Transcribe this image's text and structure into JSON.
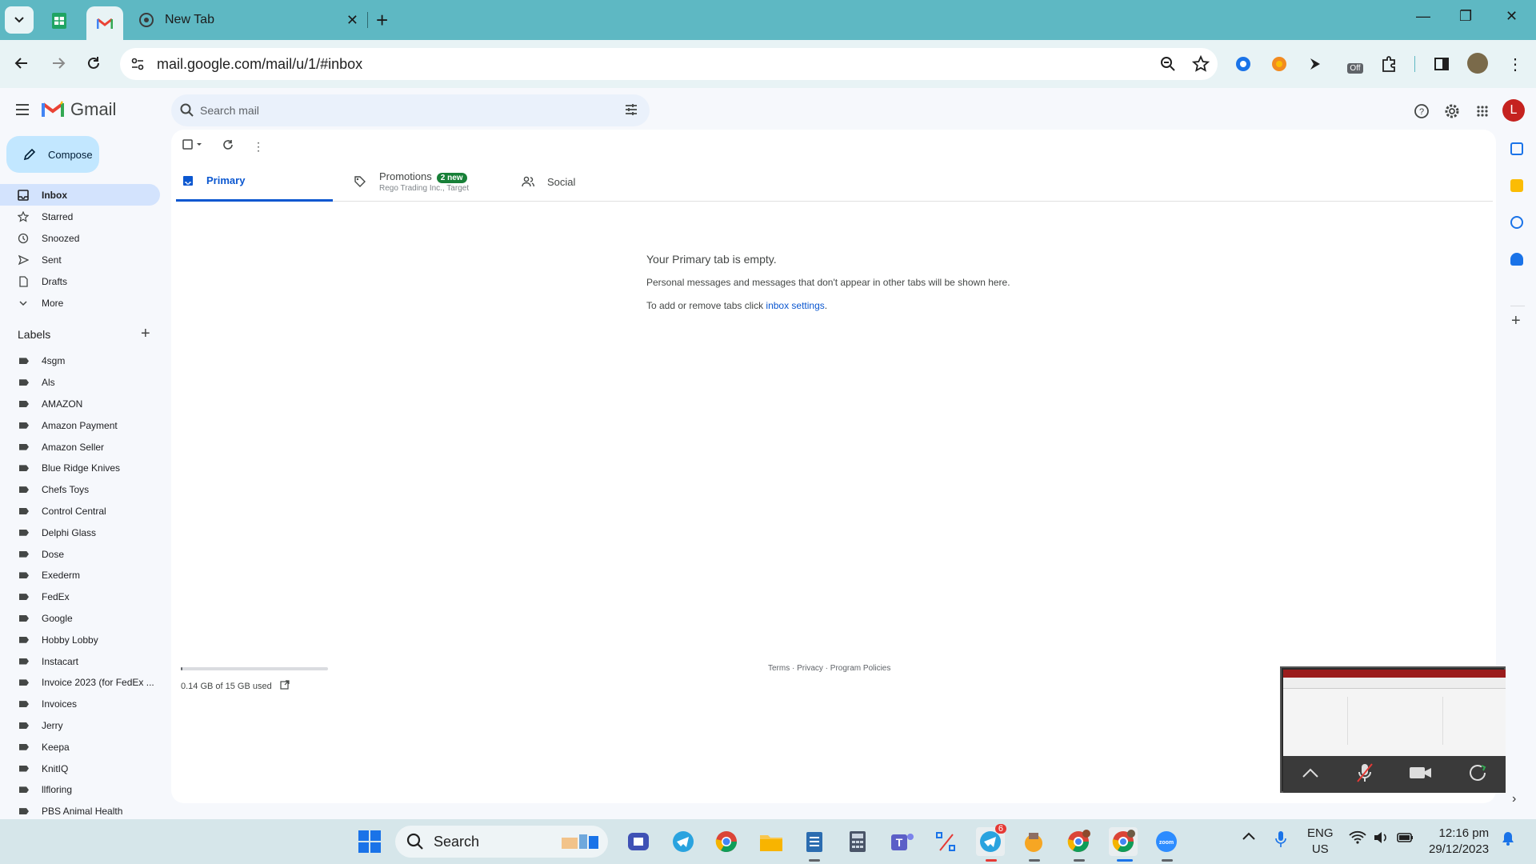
{
  "browser": {
    "tabs": [
      {
        "title": "",
        "icon": "google-sheets-icon"
      },
      {
        "title": "",
        "icon": "gmail-icon"
      },
      {
        "title": "New Tab",
        "icon": "chrome-icon"
      }
    ],
    "url": "mail.google.com/mail/u/1/#inbox",
    "extension_badge": "Off"
  },
  "gmail": {
    "logo_text": "Gmail",
    "search_placeholder": "Search mail",
    "avatar_letter": "L",
    "compose_label": "Compose",
    "nav": [
      {
        "label": "Inbox",
        "icon": "inbox-icon",
        "active": true
      },
      {
        "label": "Starred",
        "icon": "star-icon"
      },
      {
        "label": "Snoozed",
        "icon": "clock-icon"
      },
      {
        "label": "Sent",
        "icon": "send-icon"
      },
      {
        "label": "Drafts",
        "icon": "draft-icon"
      },
      {
        "label": "More",
        "icon": "chevron-down-icon"
      }
    ],
    "labels_heading": "Labels",
    "labels": [
      "4sgm",
      "Als",
      "AMAZON",
      "Amazon Payment",
      "Amazon Seller",
      "Blue Ridge Knives",
      "Chefs Toys",
      "Control Central",
      "Delphi Glass",
      "Dose",
      "Exederm",
      "FedEx",
      "Google",
      "Hobby Lobby",
      "Instacart",
      "Invoice 2023 (for FedEx ...",
      "Invoices",
      "Jerry",
      "Keepa",
      "KnitIQ",
      "llfloring",
      "PBS Animal Health"
    ],
    "category_tabs": {
      "primary": "Primary",
      "promotions": "Promotions",
      "promotions_badge": "2 new",
      "promotions_sub": "Rego Trading Inc., Target",
      "social": "Social"
    },
    "empty_title": "Your Primary tab is empty.",
    "empty_desc": "Personal messages and messages that don't appear in other tabs will be shown here.",
    "empty_hint_prefix": "To add or remove tabs click ",
    "empty_hint_link": "inbox settings",
    "empty_hint_suffix": ".",
    "storage_text": "0.14 GB of 15 GB used",
    "storage_fraction": 0.0093,
    "footer": "Terms · Privacy · Program Policies"
  },
  "taskbar": {
    "search_label": "Search",
    "telegram_badge": "6",
    "lang_line1": "ENG",
    "lang_line2": "US",
    "time": "12:16 pm",
    "date": "29/12/2023"
  },
  "colors": {
    "tabstrip": "#5eb8c3",
    "compose": "#c2e7ff",
    "inbox_active": "#d3e3fd",
    "primary_accent": "#0b57d0"
  }
}
